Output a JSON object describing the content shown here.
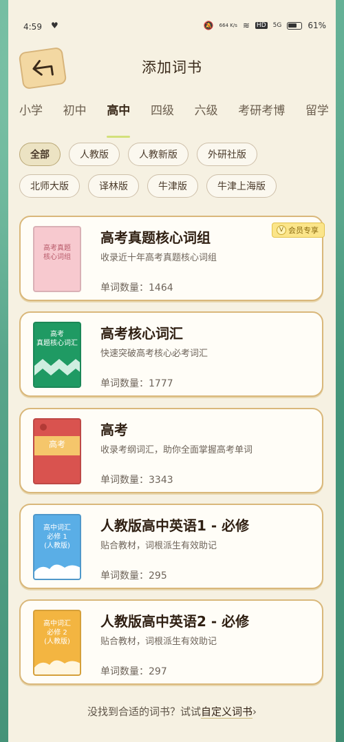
{
  "status_bar": {
    "time": "4:59",
    "net_speed": "664\nK/s",
    "hd": "HD",
    "signal": "5G",
    "battery": "61%"
  },
  "header": {
    "title": "添加词书",
    "back_icon": "back-arrow-icon"
  },
  "tabs": [
    {
      "label": "小学"
    },
    {
      "label": "初中"
    },
    {
      "label": "高中",
      "active": true
    },
    {
      "label": "四级"
    },
    {
      "label": "六级"
    },
    {
      "label": "考研考博"
    },
    {
      "label": "留学"
    }
  ],
  "filters": [
    {
      "label": "全部",
      "active": true
    },
    {
      "label": "人教版"
    },
    {
      "label": "人教新版"
    },
    {
      "label": "外研社版"
    },
    {
      "label": "北师大版"
    },
    {
      "label": "译林版"
    },
    {
      "label": "牛津版"
    },
    {
      "label": "牛津上海版"
    }
  ],
  "books": [
    {
      "title": "高考真题核心词组",
      "desc": "收录近十年高考真题核心词组",
      "count": "单词数量：1464",
      "badge": "会员专享",
      "cover_text": "高考真题\n核心词组",
      "cover_color": "#f7c9cf"
    },
    {
      "title": "高考核心词汇",
      "desc": "快速突破高考核心必考词汇",
      "count": "单词数量：1777",
      "cover_text": "高考\n真题核心词汇",
      "cover_color": "#1f9a63"
    },
    {
      "title": "高考",
      "desc": "收录考纲词汇，助你全面掌握高考单词",
      "count": "单词数量：3343",
      "cover_text": "高考",
      "cover_color": "#d9534f"
    },
    {
      "title": "人教版高中英语1 - 必修",
      "desc": "贴合教材，词根派生有效助记",
      "count": "单词数量：295",
      "cover_text": "高中词汇\n必修 1\n(人教版)",
      "cover_color": "#5aaee6"
    },
    {
      "title": "人教版高中英语2 - 必修",
      "desc": "贴合教材，词根派生有效助记",
      "count": "单词数量：297",
      "cover_text": "高中词汇\n必修 2\n(人教版)",
      "cover_color": "#f3b541"
    }
  ],
  "footer": {
    "text": "没找到合适的词书？试试",
    "link": "自定义词书",
    "chevron": "›"
  }
}
